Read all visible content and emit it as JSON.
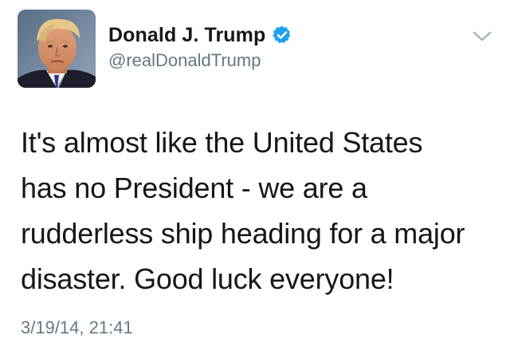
{
  "author": {
    "display_name": "Donald J. Trump",
    "handle": "@realDonaldTrump",
    "verified": true,
    "verified_color": "#1da1f2"
  },
  "tweet": {
    "lines": [
      "It's almost like the United States",
      "has no President - we are a",
      "rudderless ship heading for a major",
      "disaster. Good luck everyone!"
    ],
    "timestamp": "3/19/14, 21:41"
  },
  "icons": {
    "avatar": "profile-photo",
    "verified": "verified-badge-icon",
    "menu": "chevron-down-icon"
  },
  "colors": {
    "text": "#14171a",
    "secondary": "#657786",
    "chevron": "#aab8c2"
  }
}
